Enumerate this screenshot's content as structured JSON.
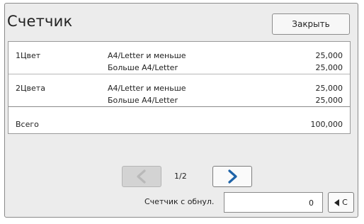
{
  "dialog": {
    "title": "Счетчик",
    "close_label": "Закрыть"
  },
  "counter_table": {
    "rows": [
      {
        "category": "1Цвет",
        "entries": [
          {
            "label": "A4/Letter и меньше",
            "value": "25,000"
          },
          {
            "label": "Больше A4/Letter",
            "value": "25,000"
          }
        ]
      },
      {
        "category": "2Цвета",
        "entries": [
          {
            "label": "A4/Letter и меньше",
            "value": "25,000"
          },
          {
            "label": "Больше A4/Letter",
            "value": "25,000"
          }
        ]
      }
    ],
    "total": {
      "label": "Всего",
      "value": "100,000"
    }
  },
  "pagination": {
    "indicator": "1/2",
    "prev_icon": "chevron-left-icon",
    "next_icon": "chevron-right-icon"
  },
  "reset_counter": {
    "label": "Счетчик с обнул.",
    "value": "0",
    "clear_label": "C",
    "clear_icon": "triangle-left-icon"
  },
  "colors": {
    "accent": "#1e63a8",
    "disabled_icon": "#b9b9b9",
    "frame_bg": "#ececec"
  }
}
